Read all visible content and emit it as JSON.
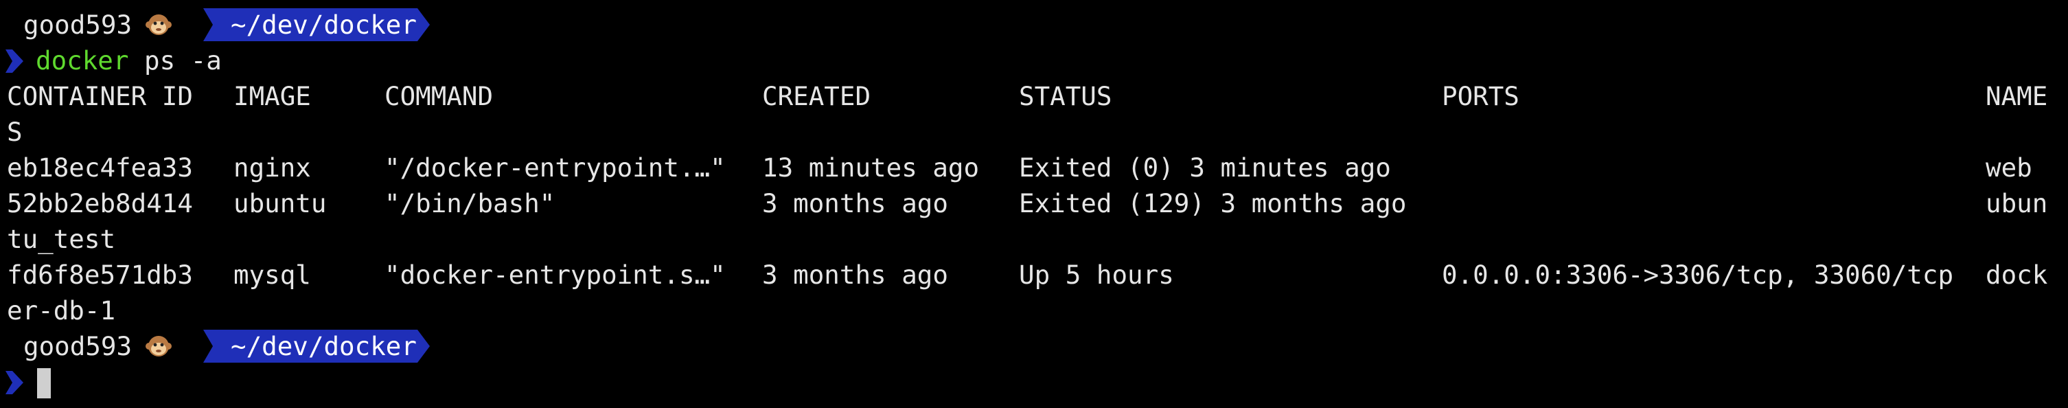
{
  "colors": {
    "background": "#000000",
    "text": "#e6e6e6",
    "prompt_accent": "#1f2fb8",
    "command": "#5fd92e"
  },
  "prompt_top": {
    "user": "good593",
    "user_icon": "monkey-face-icon",
    "path": "~/dev/docker",
    "chevron_icon": "chevron-right-icon"
  },
  "command": {
    "name": "docker",
    "args": "ps -a"
  },
  "table": {
    "headers": {
      "container_id": "CONTAINER ID",
      "image": "IMAGE",
      "command": "COMMAND",
      "created": "CREATED",
      "status": "STATUS",
      "ports": "PORTS",
      "names_part1": "NAME",
      "names_part2": "S"
    },
    "rows": [
      {
        "container_id": "eb18ec4fea33",
        "image": "nginx",
        "command": "\"/docker-entrypoint.…\"",
        "created": "13 minutes ago",
        "status": "Exited (0) 3 minutes ago",
        "ports": "",
        "names_part1": "web",
        "names_part2": ""
      },
      {
        "container_id": "52bb2eb8d414",
        "image": "ubuntu",
        "command": "\"/bin/bash\"",
        "created": "3 months ago",
        "status": "Exited (129) 3 months ago",
        "ports": "",
        "names_part1": "ubun",
        "names_part2": "tu_test"
      },
      {
        "container_id": "fd6f8e571db3",
        "image": "mysql",
        "command": "\"docker-entrypoint.s…\"",
        "created": "3 months ago",
        "status": "Up 5 hours",
        "ports": "0.0.0.0:3306->3306/tcp, 33060/tcp",
        "names_part1": "dock",
        "names_part2": "er-db-1"
      }
    ]
  },
  "prompt_bottom": {
    "user": "good593",
    "user_icon": "monkey-face-icon",
    "path": "~/dev/docker",
    "chevron_icon": "chevron-right-icon"
  }
}
